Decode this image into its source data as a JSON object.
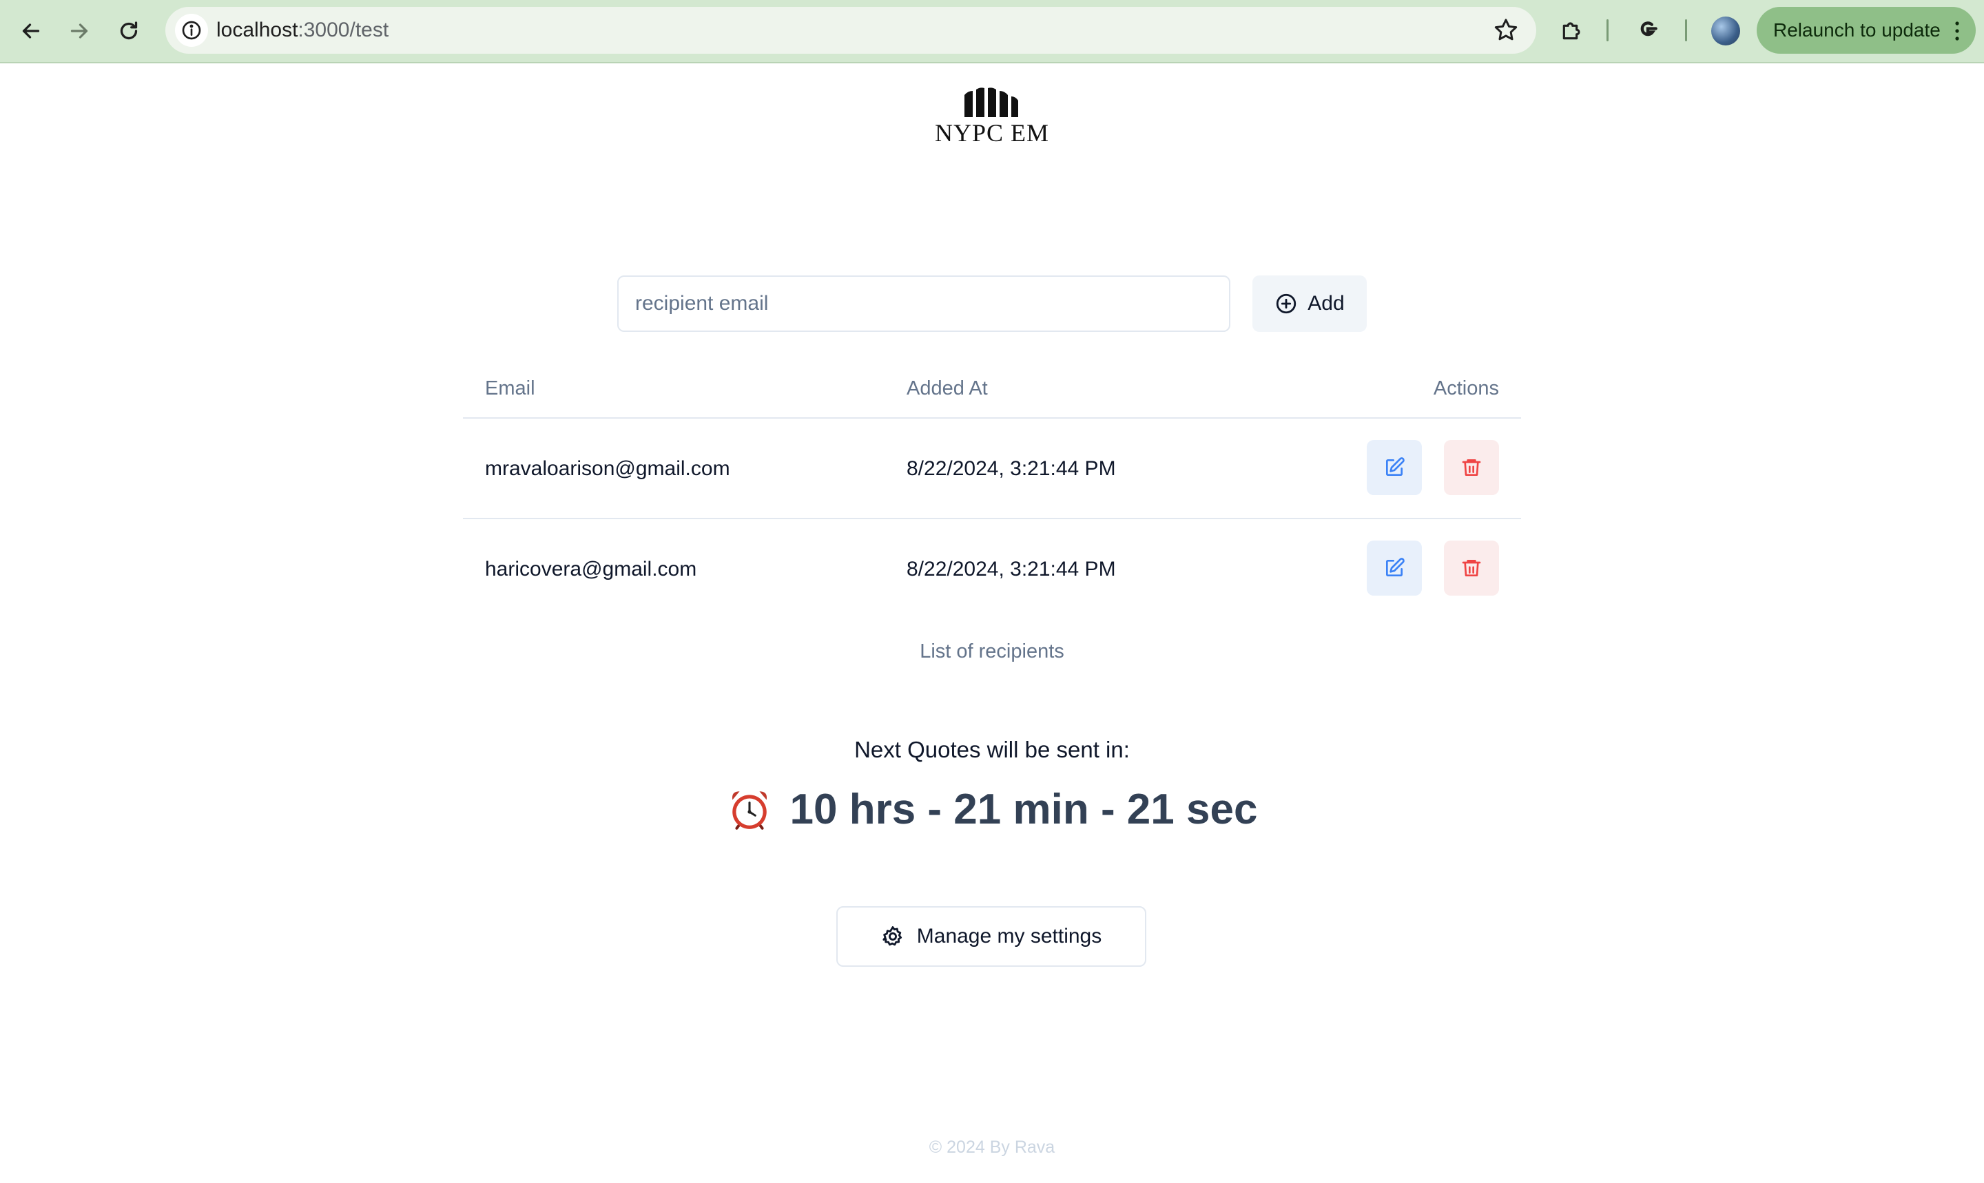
{
  "browser": {
    "url_host": "localhost",
    "url_path": ":3000/test",
    "relaunch_label": "Relaunch to update"
  },
  "logo": {
    "text": "NYPC EM"
  },
  "recipient_form": {
    "placeholder": "recipient email",
    "value": "",
    "add_label": "Add"
  },
  "table": {
    "headers": [
      "Email",
      "Added At",
      "Actions"
    ],
    "rows": [
      {
        "email": "mravaloarison@gmail.com",
        "added_at": "8/22/2024, 3:21:44 PM"
      },
      {
        "email": "haricovera@gmail.com",
        "added_at": "8/22/2024, 3:21:44 PM"
      }
    ],
    "caption": "List of recipients"
  },
  "schedule": {
    "label": "Next Quotes will be sent in:",
    "countdown": "10 hrs - 21 min - 21 sec",
    "icon": "alarm-clock-icon"
  },
  "settings_button": {
    "label": "Manage my settings"
  },
  "footer": {
    "text": "© 2024 By Rava"
  },
  "colors": {
    "chrome_bg": "#d3e8d0",
    "relaunch_bg": "#8fbf88",
    "edit_accent": "#3b82f6",
    "delete_accent": "#ef4444"
  }
}
